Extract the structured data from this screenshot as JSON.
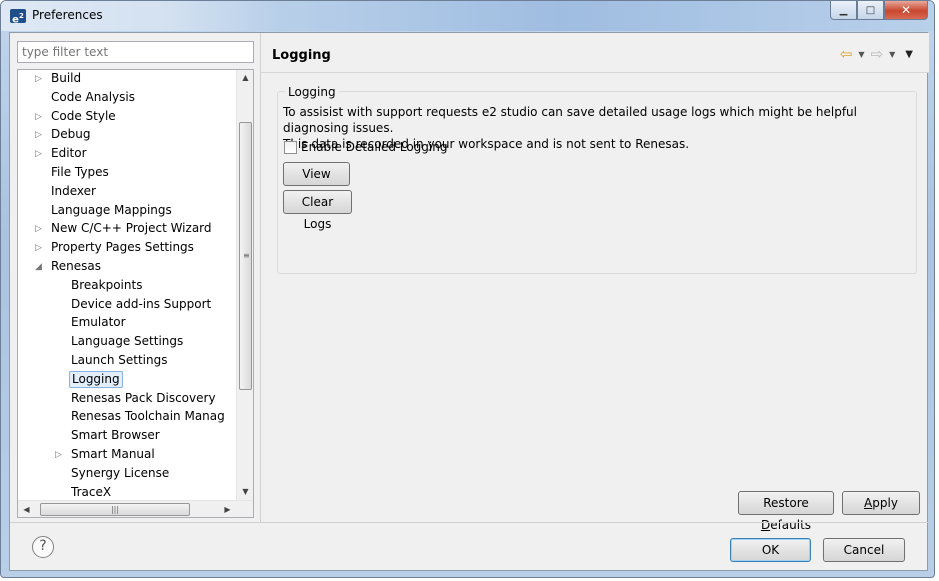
{
  "window": {
    "title": "Preferences",
    "icon_label": "e",
    "icon_sup": "2"
  },
  "filter": {
    "placeholder": "type filter text"
  },
  "tree": {
    "items": [
      {
        "label": "Build",
        "level": 1,
        "expander": "▷"
      },
      {
        "label": "Code Analysis",
        "level": 1,
        "expander": ""
      },
      {
        "label": "Code Style",
        "level": 1,
        "expander": "▷"
      },
      {
        "label": "Debug",
        "level": 1,
        "expander": "▷"
      },
      {
        "label": "Editor",
        "level": 1,
        "expander": "▷"
      },
      {
        "label": "File Types",
        "level": 1,
        "expander": ""
      },
      {
        "label": "Indexer",
        "level": 1,
        "expander": ""
      },
      {
        "label": "Language Mappings",
        "level": 1,
        "expander": ""
      },
      {
        "label": "New C/C++ Project Wizard",
        "level": 1,
        "expander": "▷"
      },
      {
        "label": "Property Pages Settings",
        "level": 1,
        "expander": "▷"
      },
      {
        "label": "Renesas",
        "level": 1,
        "expander": "◢"
      },
      {
        "label": "Breakpoints",
        "level": 2,
        "expander": ""
      },
      {
        "label": "Device add-ins Support",
        "level": 2,
        "expander": ""
      },
      {
        "label": "Emulator",
        "level": 2,
        "expander": ""
      },
      {
        "label": "Language Settings",
        "level": 2,
        "expander": ""
      },
      {
        "label": "Launch Settings",
        "level": 2,
        "expander": ""
      },
      {
        "label": "Logging",
        "level": 2,
        "expander": "",
        "selected": true
      },
      {
        "label": "Renesas Pack Discovery",
        "level": 2,
        "expander": ""
      },
      {
        "label": "Renesas Toolchain Manag",
        "level": 2,
        "expander": ""
      },
      {
        "label": "Smart Browser",
        "level": 2,
        "expander": ""
      },
      {
        "label": "Smart Manual",
        "level": 2,
        "expander": "▷"
      },
      {
        "label": "Synergy License",
        "level": 2,
        "expander": ""
      },
      {
        "label": "TraceX",
        "level": 2,
        "expander": ""
      }
    ]
  },
  "page": {
    "title": "Logging",
    "group_title": "Logging",
    "description_line1": "To assisist with support requests e2 studio can save detailed usage logs which might be helpful diagnosing issues.",
    "description_line2": "This data is recorded in your workspace and is not sent to Renesas.",
    "checkbox_label": "Enable Detailed Logging",
    "checkbox_checked": false,
    "view_logs": "View Logs",
    "clear_logs": "Clear Logs",
    "restore_defaults_pre": "Restore ",
    "restore_defaults_ul": "D",
    "restore_defaults_post": "efaults",
    "apply_ul": "A",
    "apply_post": "pply"
  },
  "dialog": {
    "ok": "OK",
    "cancel": "Cancel",
    "help": "?"
  }
}
